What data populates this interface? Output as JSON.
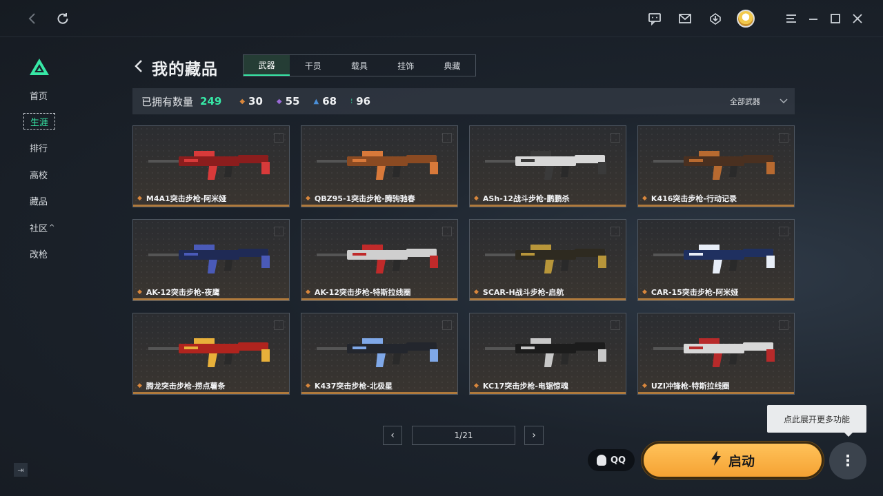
{
  "topbar": {
    "icons": [
      "back-icon",
      "refresh-icon",
      "chat-icon",
      "mail-icon",
      "download-icon",
      "avatar",
      "menu-icon",
      "minimize-icon",
      "maximize-icon",
      "close-icon"
    ]
  },
  "sidebar": {
    "items": [
      {
        "label": "首页",
        "active": false
      },
      {
        "label": "生涯",
        "active": true
      },
      {
        "label": "排行",
        "active": false
      },
      {
        "label": "高校",
        "active": false
      },
      {
        "label": "藏品",
        "active": false
      },
      {
        "label": "社区",
        "active": false
      },
      {
        "label": "改枪",
        "active": false
      }
    ],
    "community_caret": "^"
  },
  "page": {
    "title": "我的藏品",
    "tabs": [
      {
        "label": "武器",
        "active": true
      },
      {
        "label": "干员",
        "active": false
      },
      {
        "label": "载具",
        "active": false
      },
      {
        "label": "挂饰",
        "active": false
      },
      {
        "label": "典藏",
        "active": false
      }
    ]
  },
  "stats": {
    "owned_label": "已拥有数量",
    "owned_total": "249",
    "rarities": [
      {
        "color": "#d9873c",
        "count": "30"
      },
      {
        "color": "#9b6bd8",
        "count": "55"
      },
      {
        "color": "#4a8fd8",
        "count": "68"
      },
      {
        "color": "#37e8a6",
        "count": "96"
      }
    ],
    "filter_label": "全部武器"
  },
  "weapons": [
    {
      "name": "M4A1突击步枪-阿米娅",
      "body": "#8b1d1d",
      "accent": "#d83a3a"
    },
    {
      "name": "QBZ95-1突击步枪-腾驹驰春",
      "body": "#8a4a22",
      "accent": "#d8793a"
    },
    {
      "name": "ASh-12战斗步枪-鹏鹏杀",
      "body": "#d8d8d8",
      "accent": "#3a3a3a"
    },
    {
      "name": "K416突击步枪-行动记录",
      "body": "#4a3020",
      "accent": "#b86a30"
    },
    {
      "name": "AK-12突击步枪-夜鹰",
      "body": "#1f2a55",
      "accent": "#4a5ab8"
    },
    {
      "name": "AK-12突击步枪-特斯拉线圈",
      "body": "#cfcfcf",
      "accent": "#c02a2a"
    },
    {
      "name": "SCAR-H战斗步枪-启航",
      "body": "#2e2a20",
      "accent": "#b8963a"
    },
    {
      "name": "CAR-15突击步枪-阿米娅",
      "body": "#1f3060",
      "accent": "#e8eef8"
    },
    {
      "name": "腾龙突击步枪-捞点薯条",
      "body": "#b0241e",
      "accent": "#e8b03a"
    },
    {
      "name": "K437突击步枪-北极星",
      "body": "#23262d",
      "accent": "#7fa8e8"
    },
    {
      "name": "KC17突击步枪-电锯惊魂",
      "body": "#1c1c1c",
      "accent": "#c8c8c8"
    },
    {
      "name": "UZI冲锋枪-特斯拉线圈",
      "body": "#d8d8d8",
      "accent": "#b82a2a"
    }
  ],
  "pager": {
    "text": "1/21",
    "prev": "‹",
    "next": "›"
  },
  "footer": {
    "tooltip": "点此展开更多功能",
    "qq_label": "QQ",
    "launch_label": "启动",
    "more_label": "⋮",
    "collapse_label": "⇥"
  }
}
